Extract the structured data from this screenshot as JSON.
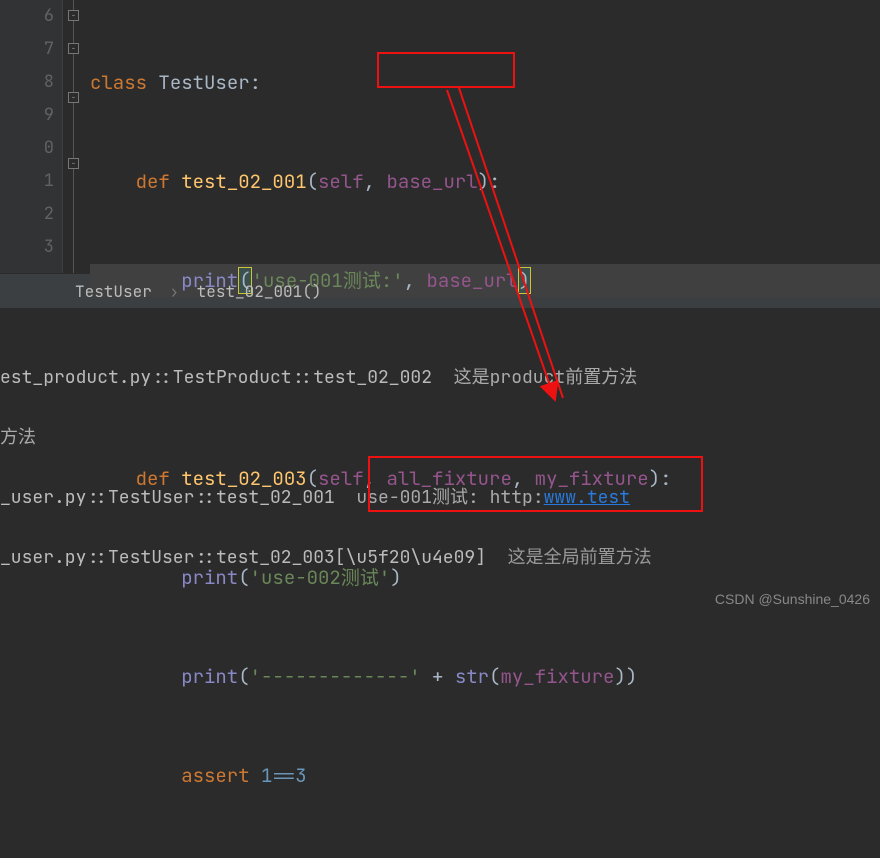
{
  "gutter": [
    "6",
    "7",
    "8",
    "9",
    "0",
    "1",
    "2",
    "3"
  ],
  "code": {
    "line6": {
      "kw1": "class",
      "cls": " TestUser",
      "colon": ":"
    },
    "line7": {
      "kw1": "def ",
      "fn": "test_02_001",
      "lp": "(",
      "self": "self",
      "sep": ", ",
      "p1": "base_url",
      "rp": "):"
    },
    "line8": {
      "fn": "print",
      "lp": "(",
      "str": "'use-001测试:'",
      "sep": ", ",
      "p1": "base_url",
      "rp": ")"
    },
    "line10": {
      "kw1": "def ",
      "fn": "test_02_003",
      "lp": "(",
      "self": "self",
      "sep1": ", ",
      "p1": "all_fixture",
      "sep2": ", ",
      "p2": "my_fixture",
      "rp": "):"
    },
    "line11": {
      "fn": "print",
      "lp": "(",
      "str": "'use-002测试'",
      "rp": ")"
    },
    "line12": {
      "fn": "print",
      "lp": "(",
      "str": "'-------------'",
      "plus": " + ",
      "builtin": "str",
      "lp2": "(",
      "p1": "my_fixture",
      "rp2": ")",
      ")": ")"
    },
    "line13": {
      "kw": "assert ",
      "cond": "1==3"
    }
  },
  "breadcrumb": {
    "a": "TestUser",
    "b": "test_02_001()"
  },
  "console": {
    "l1a": "est_product.py::TestProduct::test_02_002",
    "l1b": "  这是product前置方法",
    "l2": "方法",
    "l3a": "_user.py::TestUser::test_02_001",
    "l3b": "use-001测试: http:",
    "l3c": "www.test",
    "l4a": "_user.py::TestUser::test_02_003[\\u5f20\\u4e09]",
    "l4b": "  这是全局前置方法"
  },
  "watermark": "CSDN @Sunshine_0426"
}
